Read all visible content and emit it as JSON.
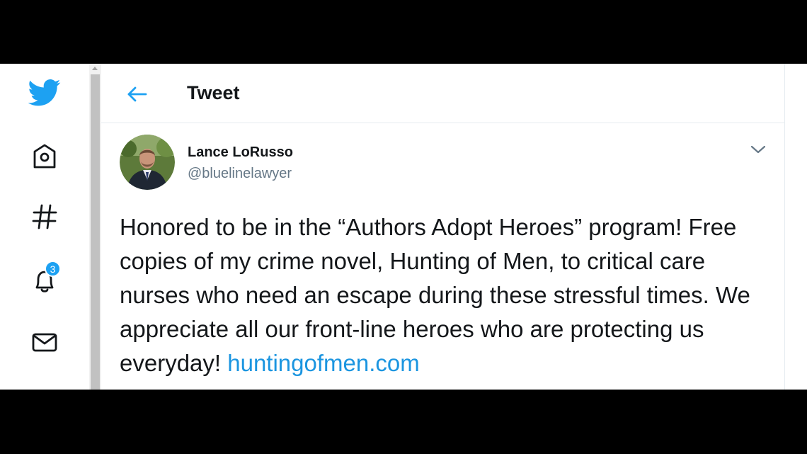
{
  "nav": {
    "logo_icon": "twitter-bird-icon",
    "items": [
      {
        "icon": "home-icon"
      },
      {
        "icon": "hashtag-icon"
      },
      {
        "icon": "bell-icon",
        "badge": "3"
      },
      {
        "icon": "mail-icon"
      }
    ]
  },
  "header": {
    "back_icon": "arrow-left-icon",
    "title": "Tweet"
  },
  "tweet": {
    "author_name": "Lance LoRusso",
    "author_handle": "@bluelinelawyer",
    "menu_icon": "chevron-down-icon",
    "text": "Honored to be in the “Authors Adopt Heroes” program! Free copies of my crime novel, Hunting of Men, to critical care nurses who need an escape during these stressful times. We appreciate all our front-line heroes who are protecting us everyday! ",
    "link": "huntingofmen.com"
  },
  "colors": {
    "brand": "#1da1f2",
    "link": "#1b95e0",
    "text": "#14171a",
    "secondary": "#657786",
    "border": "#e6ecf0"
  }
}
